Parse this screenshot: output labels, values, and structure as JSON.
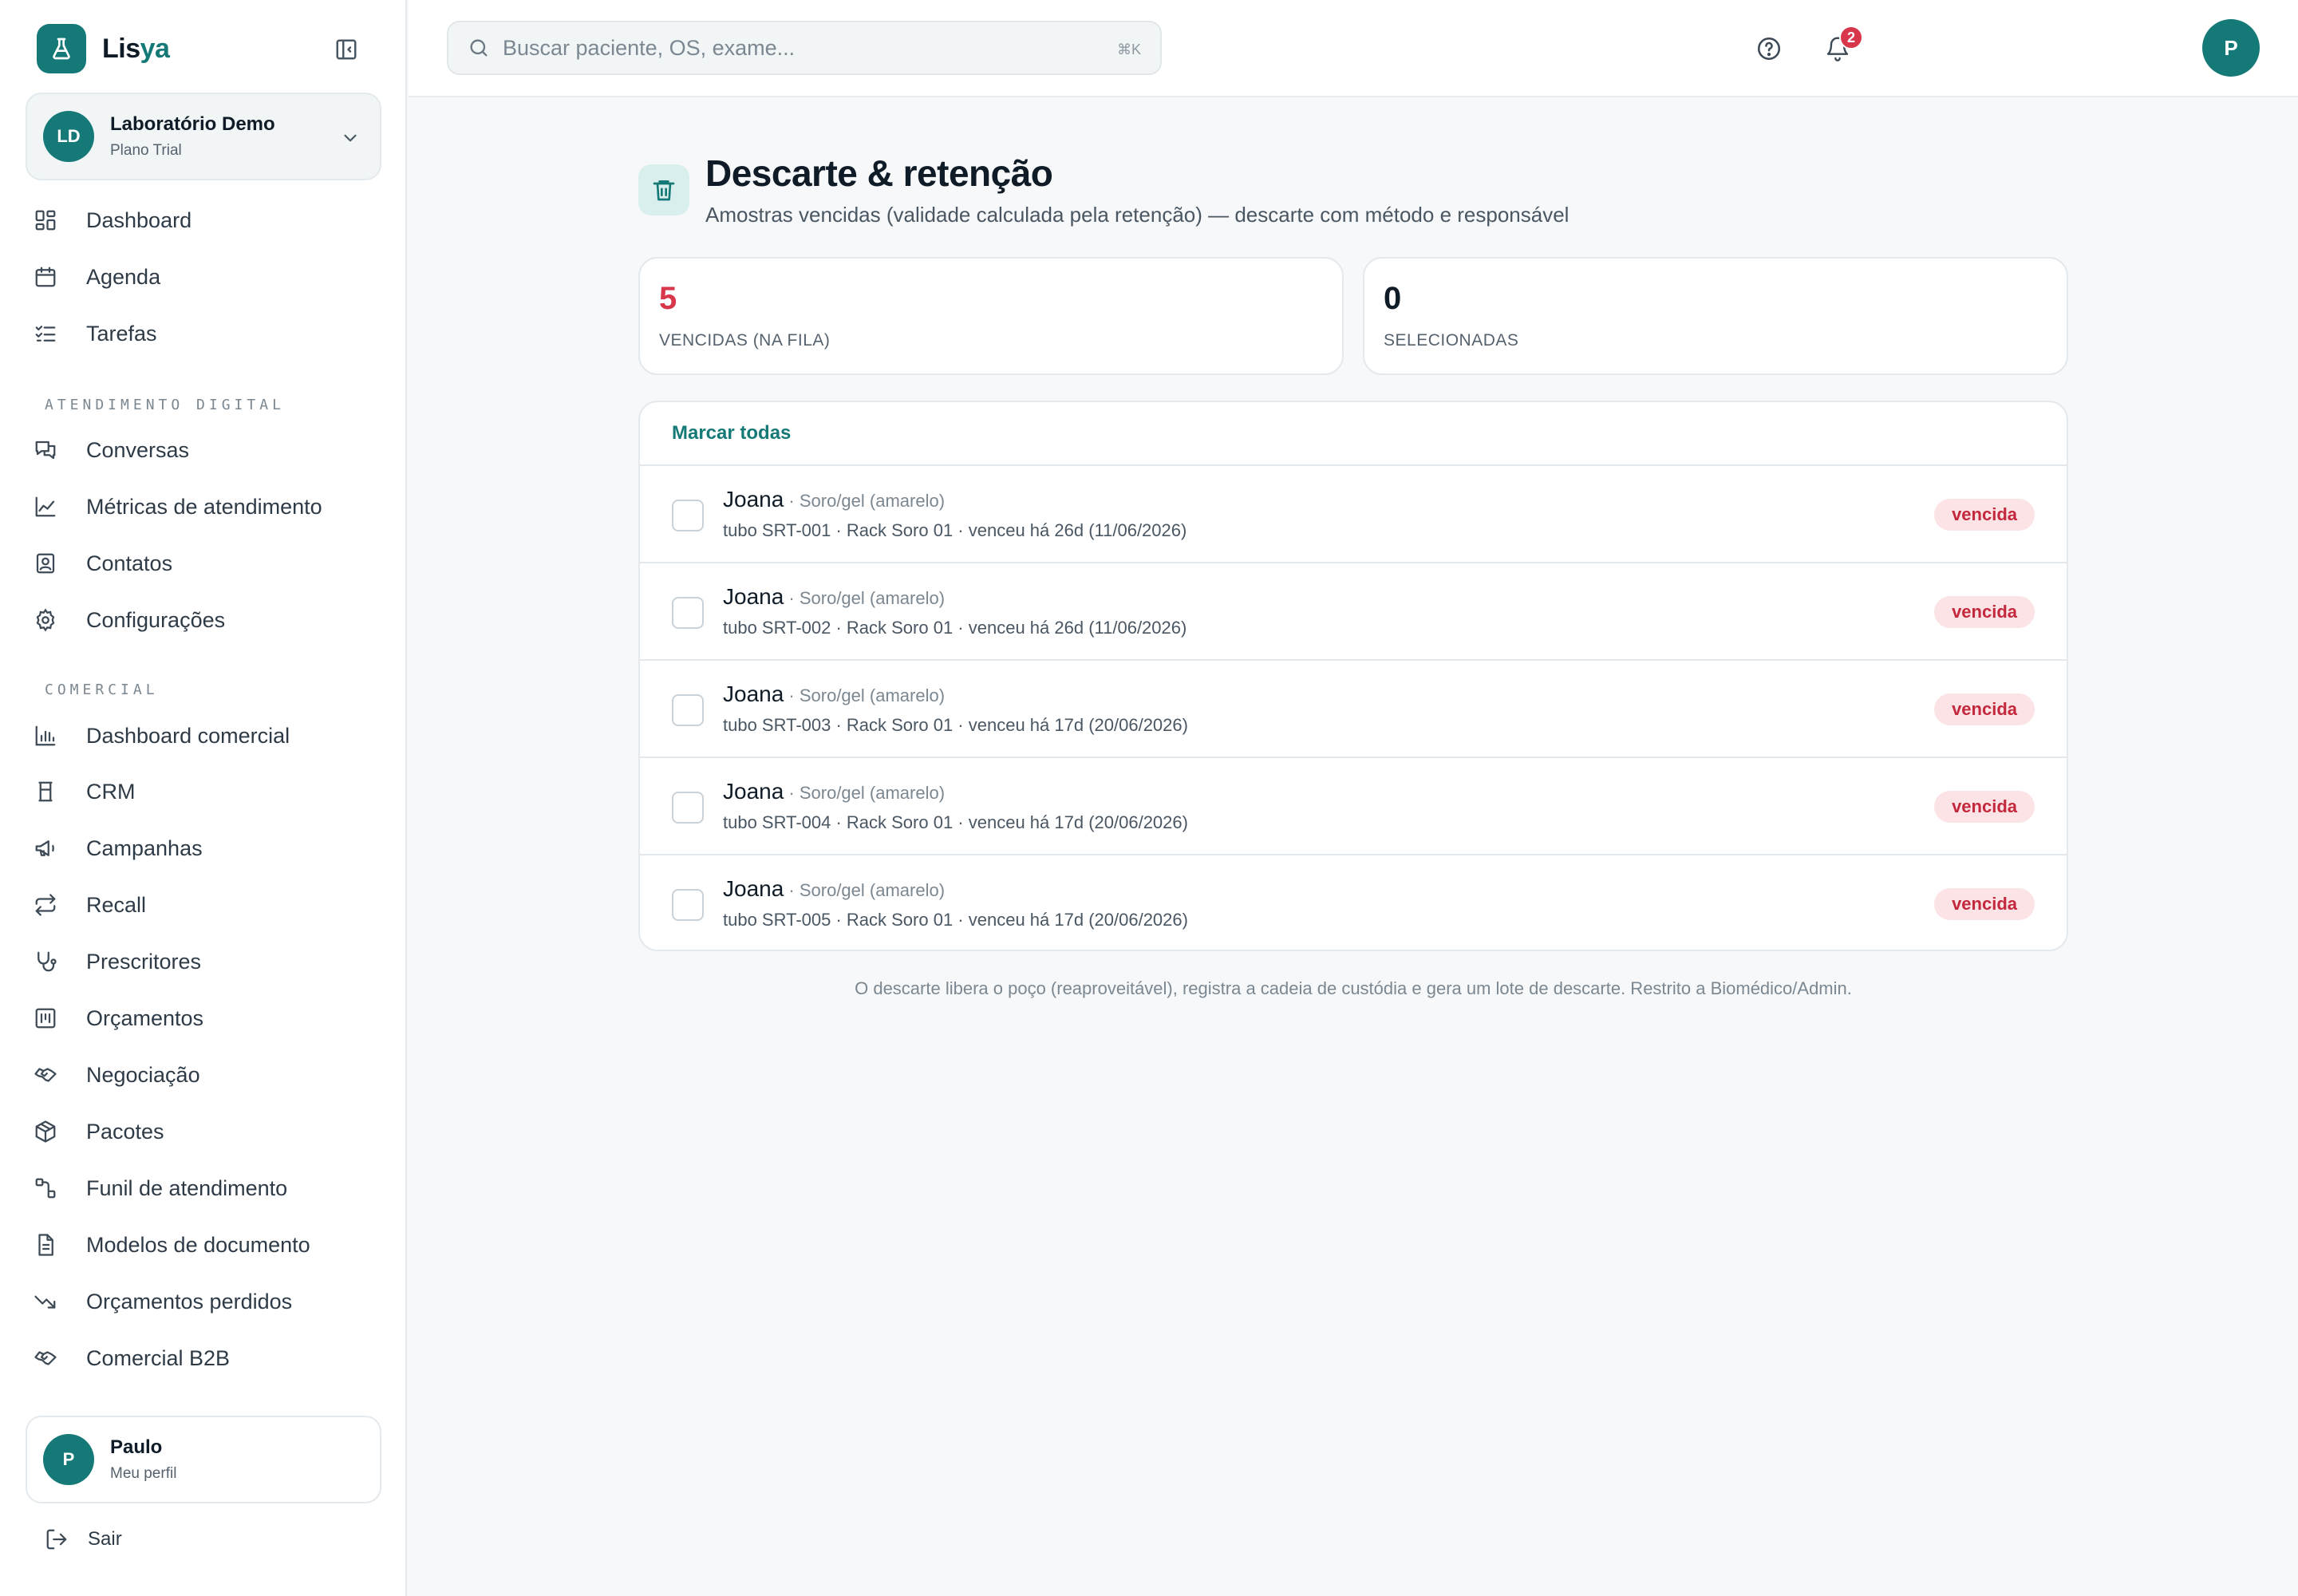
{
  "brand": {
    "name_main": "Lis",
    "name_accent": "ya"
  },
  "org": {
    "initials": "LD",
    "name": "Laboratório Demo",
    "plan": "Plano Trial"
  },
  "nav": {
    "top": [
      {
        "label": "Dashboard",
        "icon": "dashboard-icon"
      },
      {
        "label": "Agenda",
        "icon": "calendar-icon"
      },
      {
        "label": "Tarefas",
        "icon": "checklist-icon"
      }
    ],
    "section1": "ATENDIMENTO DIGITAL",
    "digital": [
      {
        "label": "Conversas",
        "icon": "chat-icon"
      },
      {
        "label": "Métricas de atendimento",
        "icon": "line-chart-icon"
      },
      {
        "label": "Contatos",
        "icon": "contact-icon"
      },
      {
        "label": "Configurações",
        "icon": "gear-icon"
      }
    ],
    "section2": "COMERCIAL",
    "comercial": [
      {
        "label": "Dashboard comercial",
        "icon": "bar-chart-icon"
      },
      {
        "label": "CRM",
        "icon": "crm-icon"
      },
      {
        "label": "Campanhas",
        "icon": "megaphone-icon"
      },
      {
        "label": "Recall",
        "icon": "repeat-icon"
      },
      {
        "label": "Prescritores",
        "icon": "stethoscope-icon"
      },
      {
        "label": "Orçamentos",
        "icon": "quote-icon"
      },
      {
        "label": "Negociação",
        "icon": "handshake-icon"
      },
      {
        "label": "Pacotes",
        "icon": "package-icon"
      },
      {
        "label": "Funil de atendimento",
        "icon": "funnel-icon"
      },
      {
        "label": "Modelos de documento",
        "icon": "document-icon"
      },
      {
        "label": "Orçamentos perdidos",
        "icon": "trending-down-icon"
      },
      {
        "label": "Comercial B2B",
        "icon": "handshake-icon"
      }
    ]
  },
  "user": {
    "initial": "P",
    "name": "Paulo",
    "sub": "Meu perfil"
  },
  "logout_label": "Sair",
  "search": {
    "placeholder": "Buscar paciente, OS, exame...",
    "shortcut": "⌘K"
  },
  "notifications": {
    "count": "2"
  },
  "top_avatar": "P",
  "page": {
    "title": "Descarte & retenção",
    "subtitle": "Amostras vencidas (validade calculada pela retenção) — descarte com método e responsável"
  },
  "stats": [
    {
      "value": "5",
      "label": "VENCIDAS (NA FILA)",
      "color": "#d8374b"
    },
    {
      "value": "0",
      "label": "SELECIONADAS",
      "color": "#0f1b26"
    }
  ],
  "list": {
    "mark_all": "Marcar todas",
    "rows": [
      {
        "name": "Joana",
        "type": " · Soro/gel (amarelo)",
        "detail": "tubo SRT-001 · Rack Soro 01 · venceu há 26d (11/06/2026)",
        "status": "vencida"
      },
      {
        "name": "Joana",
        "type": " · Soro/gel (amarelo)",
        "detail": "tubo SRT-002 · Rack Soro 01 · venceu há 26d (11/06/2026)",
        "status": "vencida"
      },
      {
        "name": "Joana",
        "type": " · Soro/gel (amarelo)",
        "detail": "tubo SRT-003 · Rack Soro 01 · venceu há 17d (20/06/2026)",
        "status": "vencida"
      },
      {
        "name": "Joana",
        "type": " · Soro/gel (amarelo)",
        "detail": "tubo SRT-004 · Rack Soro 01 · venceu há 17d (20/06/2026)",
        "status": "vencida"
      },
      {
        "name": "Joana",
        "type": " · Soro/gel (amarelo)",
        "detail": "tubo SRT-005 · Rack Soro 01 · venceu há 17d (20/06/2026)",
        "status": "vencida"
      }
    ]
  },
  "footer_note": "O descarte libera o poço (reaproveitável), registra a cadeia de custódia e gera um lote de descarte. Restrito a Biomédico/Admin.",
  "colors": {
    "brand": "#157a77",
    "danger": "#d8374b",
    "pill_bg": "#fbe3e6"
  }
}
